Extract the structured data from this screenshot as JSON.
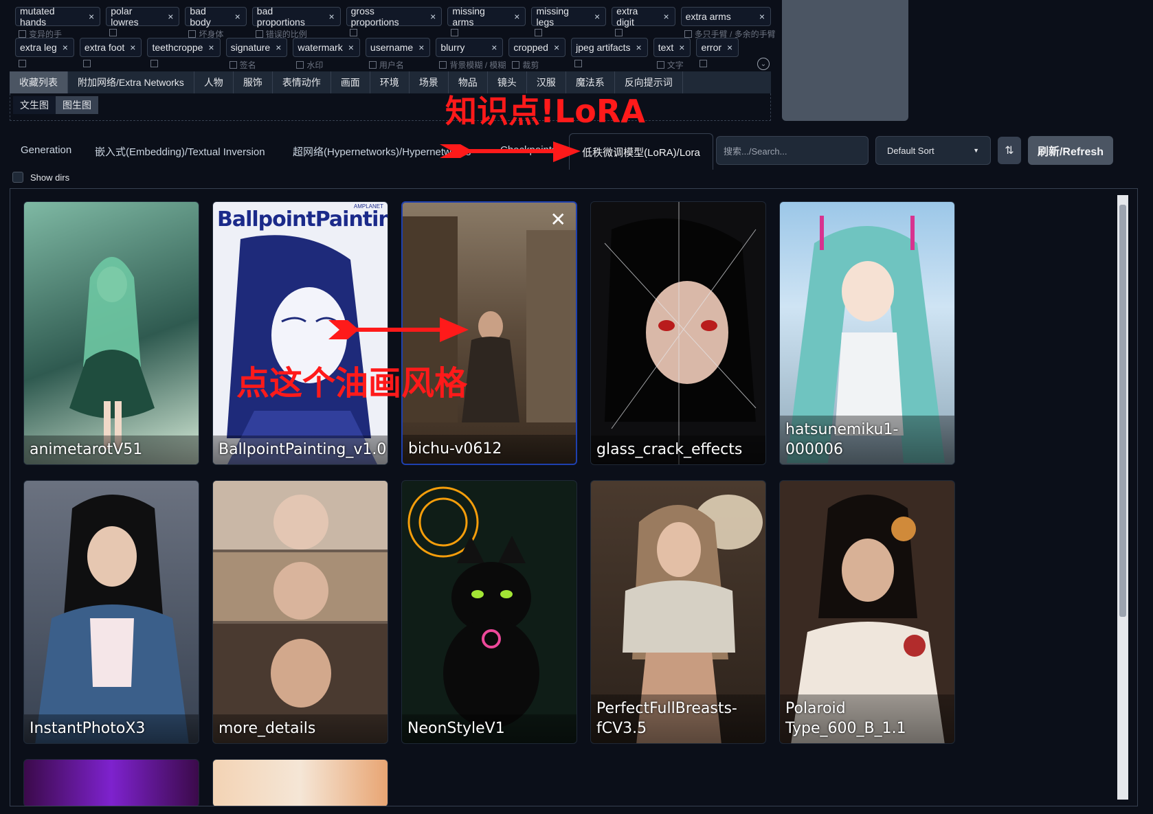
{
  "tags_row1": [
    {
      "label": "mutated hands",
      "sub": "变异的手"
    },
    {
      "label": "polar lowres",
      "sub": ""
    },
    {
      "label": "bad body",
      "sub": "坏身体"
    },
    {
      "label": "bad proportions",
      "sub": "错误的比例"
    },
    {
      "label": "gross proportions",
      "sub": ""
    },
    {
      "label": "missing arms",
      "sub": ""
    },
    {
      "label": "missing legs",
      "sub": ""
    },
    {
      "label": "extra digit",
      "sub": ""
    },
    {
      "label": "extra arms",
      "sub": "多只手臂 / 多余的手臂"
    }
  ],
  "tags_row2": [
    {
      "label": "extra leg",
      "sub": ""
    },
    {
      "label": "extra foot",
      "sub": ""
    },
    {
      "label": "teethcroppe",
      "sub": ""
    },
    {
      "label": "signature",
      "sub": "签名"
    },
    {
      "label": "watermark",
      "sub": "水印"
    },
    {
      "label": "username",
      "sub": "用户名"
    },
    {
      "label": "blurry",
      "sub": "背景模糊 / 模糊"
    },
    {
      "label": "cropped",
      "sub": "裁剪"
    },
    {
      "label": "jpeg artifacts",
      "sub": ""
    },
    {
      "label": "text",
      "sub": "文字"
    },
    {
      "label": "error",
      "sub": ""
    }
  ],
  "remove_glyph": "×",
  "category_tabs": [
    "收藏列表",
    "附加网络/Extra Networks",
    "人物",
    "服饰",
    "表情动作",
    "画面",
    "环境",
    "场景",
    "物品",
    "镜头",
    "汉服",
    "魔法系",
    "反向提示词"
  ],
  "sub_tabs": [
    "文生图",
    "图生图"
  ],
  "annotations": {
    "top": "知识点!LoRA",
    "mid": "点这个油画风格"
  },
  "extra_tabs": {
    "generation": "Generation",
    "embedding": "嵌入式(Embedding)/Textual Inversion",
    "hyper": "超网络(Hypernetworks)/Hypernetworks",
    "checkpoints": "Checkpoints",
    "lora": "低秩微调模型(LoRA)/Lora"
  },
  "search": {
    "placeholder": "搜索.../Search..."
  },
  "sort": {
    "value": "Default Sort"
  },
  "refresh_label": "刷新/Refresh",
  "show_dirs_label": "Show dirs",
  "cards": [
    {
      "name": "animetarotV51"
    },
    {
      "name": "BallpointPainting_v1.0",
      "inner_text": "BallpointPainting",
      "brand": "AMPLANET"
    },
    {
      "name": "bichu-v0612"
    },
    {
      "name": "glass_crack_effects"
    },
    {
      "name": "hatsunemiku1-000006"
    },
    {
      "name": "InstantPhotoX3"
    },
    {
      "name": "more_details"
    },
    {
      "name": "NeonStyleV1"
    },
    {
      "name": "PerfectFullBreasts-fCV3.5"
    },
    {
      "name": "Polaroid Type_600_B_1.1"
    }
  ],
  "colors": {
    "annotation": "#ff1a1a",
    "selected_border": "#1e40af",
    "bg": "#0b0f19"
  }
}
